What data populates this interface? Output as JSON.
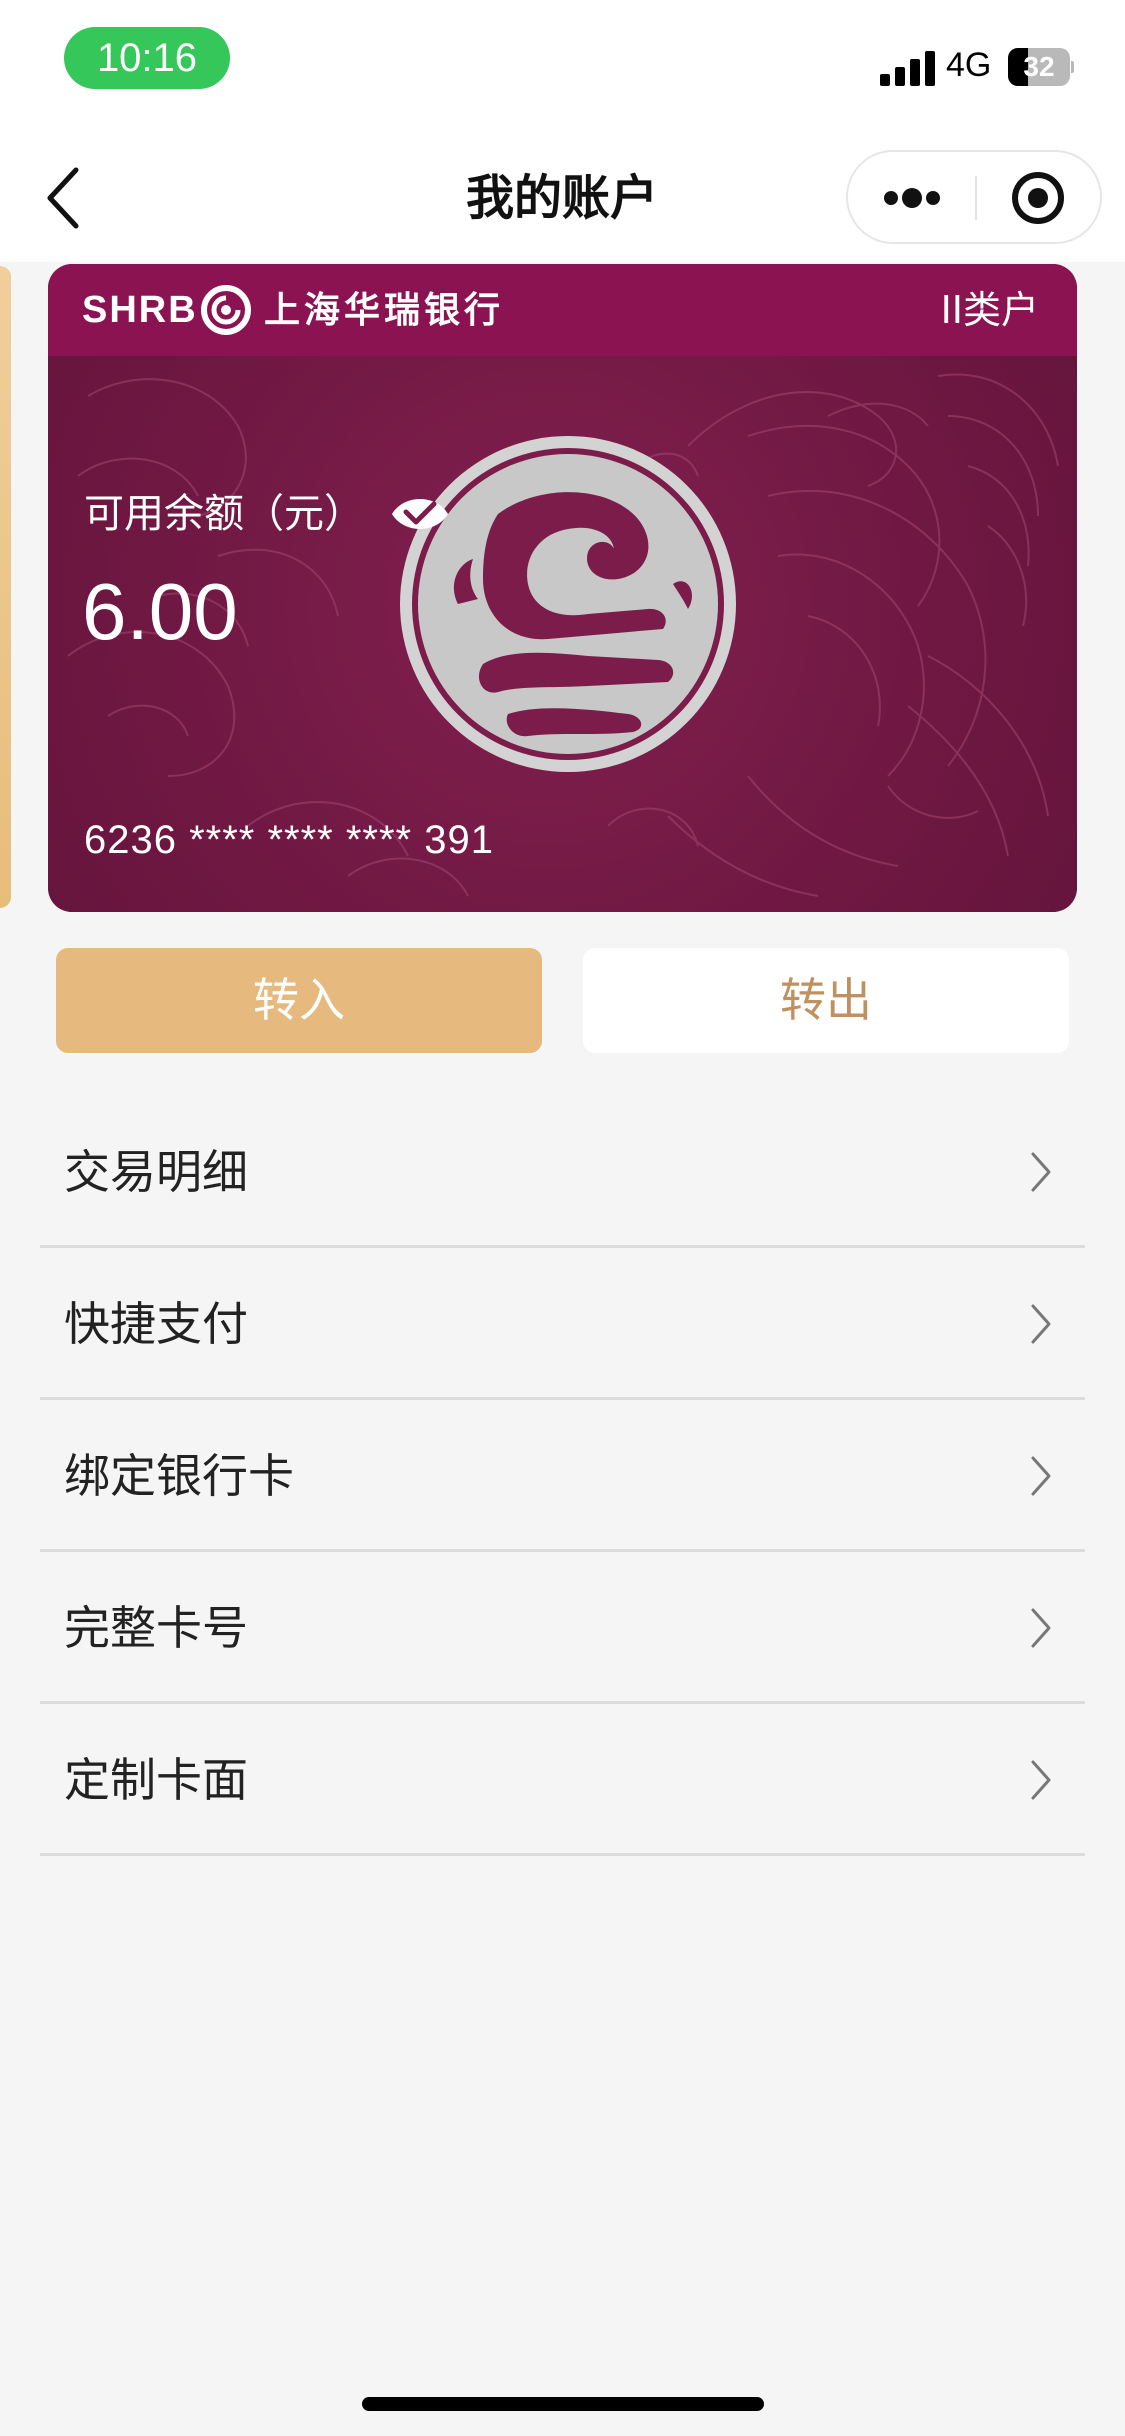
{
  "status_bar": {
    "time": "10:16",
    "network": "4G",
    "battery": "32",
    "battery_level": 0.32
  },
  "nav": {
    "title": "我的账户",
    "back_icon": "chevron-left-icon",
    "more_icon": "more-dots-icon",
    "close_icon": "target-close-icon"
  },
  "card": {
    "bank_en": "SHRB",
    "bank_cn": "上海华瑞银行",
    "account_type": "II类户",
    "balance_label": "可用余额（元）",
    "balance": "6.00",
    "card_number": "6236 **** **** **** 391",
    "colors": {
      "header": "#8b1352",
      "body": "#701843"
    }
  },
  "actions": {
    "transfer_in": "转入",
    "transfer_out": "转出",
    "accent": "#e6b97e"
  },
  "menu": [
    {
      "label": "交易明细"
    },
    {
      "label": "快捷支付"
    },
    {
      "label": "绑定银行卡"
    },
    {
      "label": "完整卡号"
    },
    {
      "label": "定制卡面"
    }
  ]
}
